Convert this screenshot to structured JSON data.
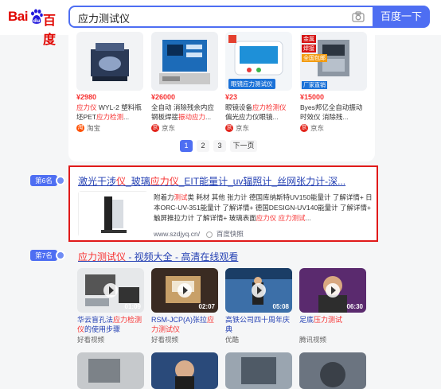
{
  "header": {
    "logo_text_bai": "Bai",
    "logo_text_du": "百度",
    "query": "应力测试仪",
    "search_button": "百度一下"
  },
  "products": [
    {
      "price": "¥2980",
      "title_hl": "应力仪",
      "title_rest": " WYL-2 塑料瓶坯PET",
      "title_hl2": "应力检测",
      "title_rest2": "...",
      "shop": "淘宝",
      "shop_color": "#ff5000",
      "shop_glyph": "淘"
    },
    {
      "price": "¥26000",
      "title_hl": "",
      "title_rest": "全自动 消除残余内应钢板焊接",
      "title_hl2": "振动应力",
      "title_rest2": "...",
      "shop": "京东",
      "shop_color": "#e2231a",
      "shop_glyph": "京"
    },
    {
      "price": "¥23",
      "title_hl": "",
      "title_rest": "眼镜设备",
      "title_hl2": "应力检测仪",
      "title_rest2": " 偏光应力仪眼镜...",
      "shop": "京东",
      "shop_color": "#e2231a",
      "shop_glyph": "京",
      "badge": "眼镜应力测试仪"
    },
    {
      "price": "¥15000",
      "title_hl": "",
      "title_rest": "Byes邦亿全自动振动时效仪 消除残",
      "title_hl2": "",
      "title_rest2": "...",
      "shop": "京东",
      "shop_color": "#e2231a",
      "shop_glyph": "京",
      "tags": [
        "金属",
        "焊接",
        "全国包邮",
        "厂家直销"
      ]
    }
  ],
  "pager": {
    "pages": [
      "1",
      "2",
      "3"
    ],
    "next": "下一页"
  },
  "rank6": "第6名",
  "result6": {
    "title_parts": [
      {
        "t": "激光干涉",
        "h": false
      },
      {
        "t": "仪",
        "h": true
      },
      {
        "t": "_玻璃",
        "h": false
      },
      {
        "t": "应力仪",
        "h": true
      },
      {
        "t": "_EIT能量计_uv辐照计_丝网张力计-深...",
        "h": false
      }
    ],
    "desc_parts": [
      {
        "t": "附着力",
        "h": false
      },
      {
        "t": "测试",
        "h": true
      },
      {
        "t": "类 耗材 其他 张力计 德国库纳斯特UV150能量计 了解详情+ 日本ORC-UV-351能量计 了解详情+ 德国DESIGN-UV140能量计 了解详情+ 触屏推拉力计 了解详情+ 玻璃表面",
        "h": false
      },
      {
        "t": "应力仪",
        "h": true
      },
      {
        "t": " ",
        "h": false
      },
      {
        "t": "应力测试",
        "h": true
      },
      {
        "t": "...",
        "h": false
      }
    ],
    "url": "www.szdjyq.cn/",
    "snapshot": "百度快照"
  },
  "rank7": "第7名",
  "result7": {
    "title_hl": "应力测试仪",
    "title_rest": " - 视频大全 - 高清在线观看"
  },
  "videos": [
    {
      "duration": "01:09",
      "t1": "华云盲孔法",
      "h1": "应力检测仪",
      "t2": "的使用步骤",
      "source": "好看视频"
    },
    {
      "duration": "02:07",
      "t1": "RSM-JCP(A)张拉",
      "h1": "应力测试仪",
      "t2": "",
      "source": "好看视频"
    },
    {
      "duration": "05:08",
      "t1": "高铁公司四十周年庆典",
      "h1": "",
      "t2": "",
      "source": "优酷"
    },
    {
      "duration": "06:30",
      "t1": "足底",
      "h1": "压力测试",
      "t2": "",
      "source": "腾讯视频"
    }
  ]
}
